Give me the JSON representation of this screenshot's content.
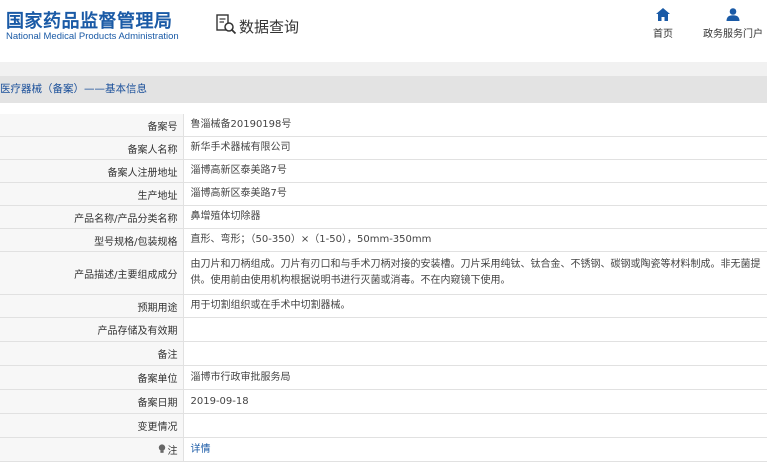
{
  "header": {
    "logo_cn": "国家药品监督管理局",
    "logo_en": "National Medical Products Administration",
    "search_title": "数据查询",
    "nav": {
      "home": "首页",
      "portal": "政务服务门户"
    }
  },
  "breadcrumb": "医疗器械（备案）——基本信息",
  "rows": [
    {
      "label": "备案号",
      "value": "鲁淄械备20190198号"
    },
    {
      "label": "备案人名称",
      "value": "新华手术器械有限公司"
    },
    {
      "label": "备案人注册地址",
      "value": "淄博高新区泰美路7号"
    },
    {
      "label": "生产地址",
      "value": "淄博高新区泰美路7号"
    },
    {
      "label": "产品名称/产品分类名称",
      "value": "鼻增殖体切除器"
    },
    {
      "label": "型号规格/包装规格",
      "value": "直形、弯形；（50-350）×（1-50），50mm-350mm"
    },
    {
      "label": "产品描述/主要组成成分",
      "value": "由刀片和刀柄组成。刀片有刃口和与手术刀柄对接的安装槽。刀片采用纯钛、钛合金、不锈钢、碳钢或陶瓷等材料制成。非无菌提供。使用前由使用机构根据说明书进行灭菌或消毒。不在内窥镜下使用。"
    },
    {
      "label": "预期用途",
      "value": "用于切割组织或在手术中切割器械。"
    },
    {
      "label": "产品存储及有效期",
      "value": ""
    },
    {
      "label": "备注",
      "value": ""
    },
    {
      "label": "备案单位",
      "value": "淄博市行政审批服务局"
    },
    {
      "label": "备案日期",
      "value": "2019-09-18"
    },
    {
      "label": "变更情况",
      "value": ""
    },
    {
      "label": "注",
      "value": "详情"
    }
  ]
}
